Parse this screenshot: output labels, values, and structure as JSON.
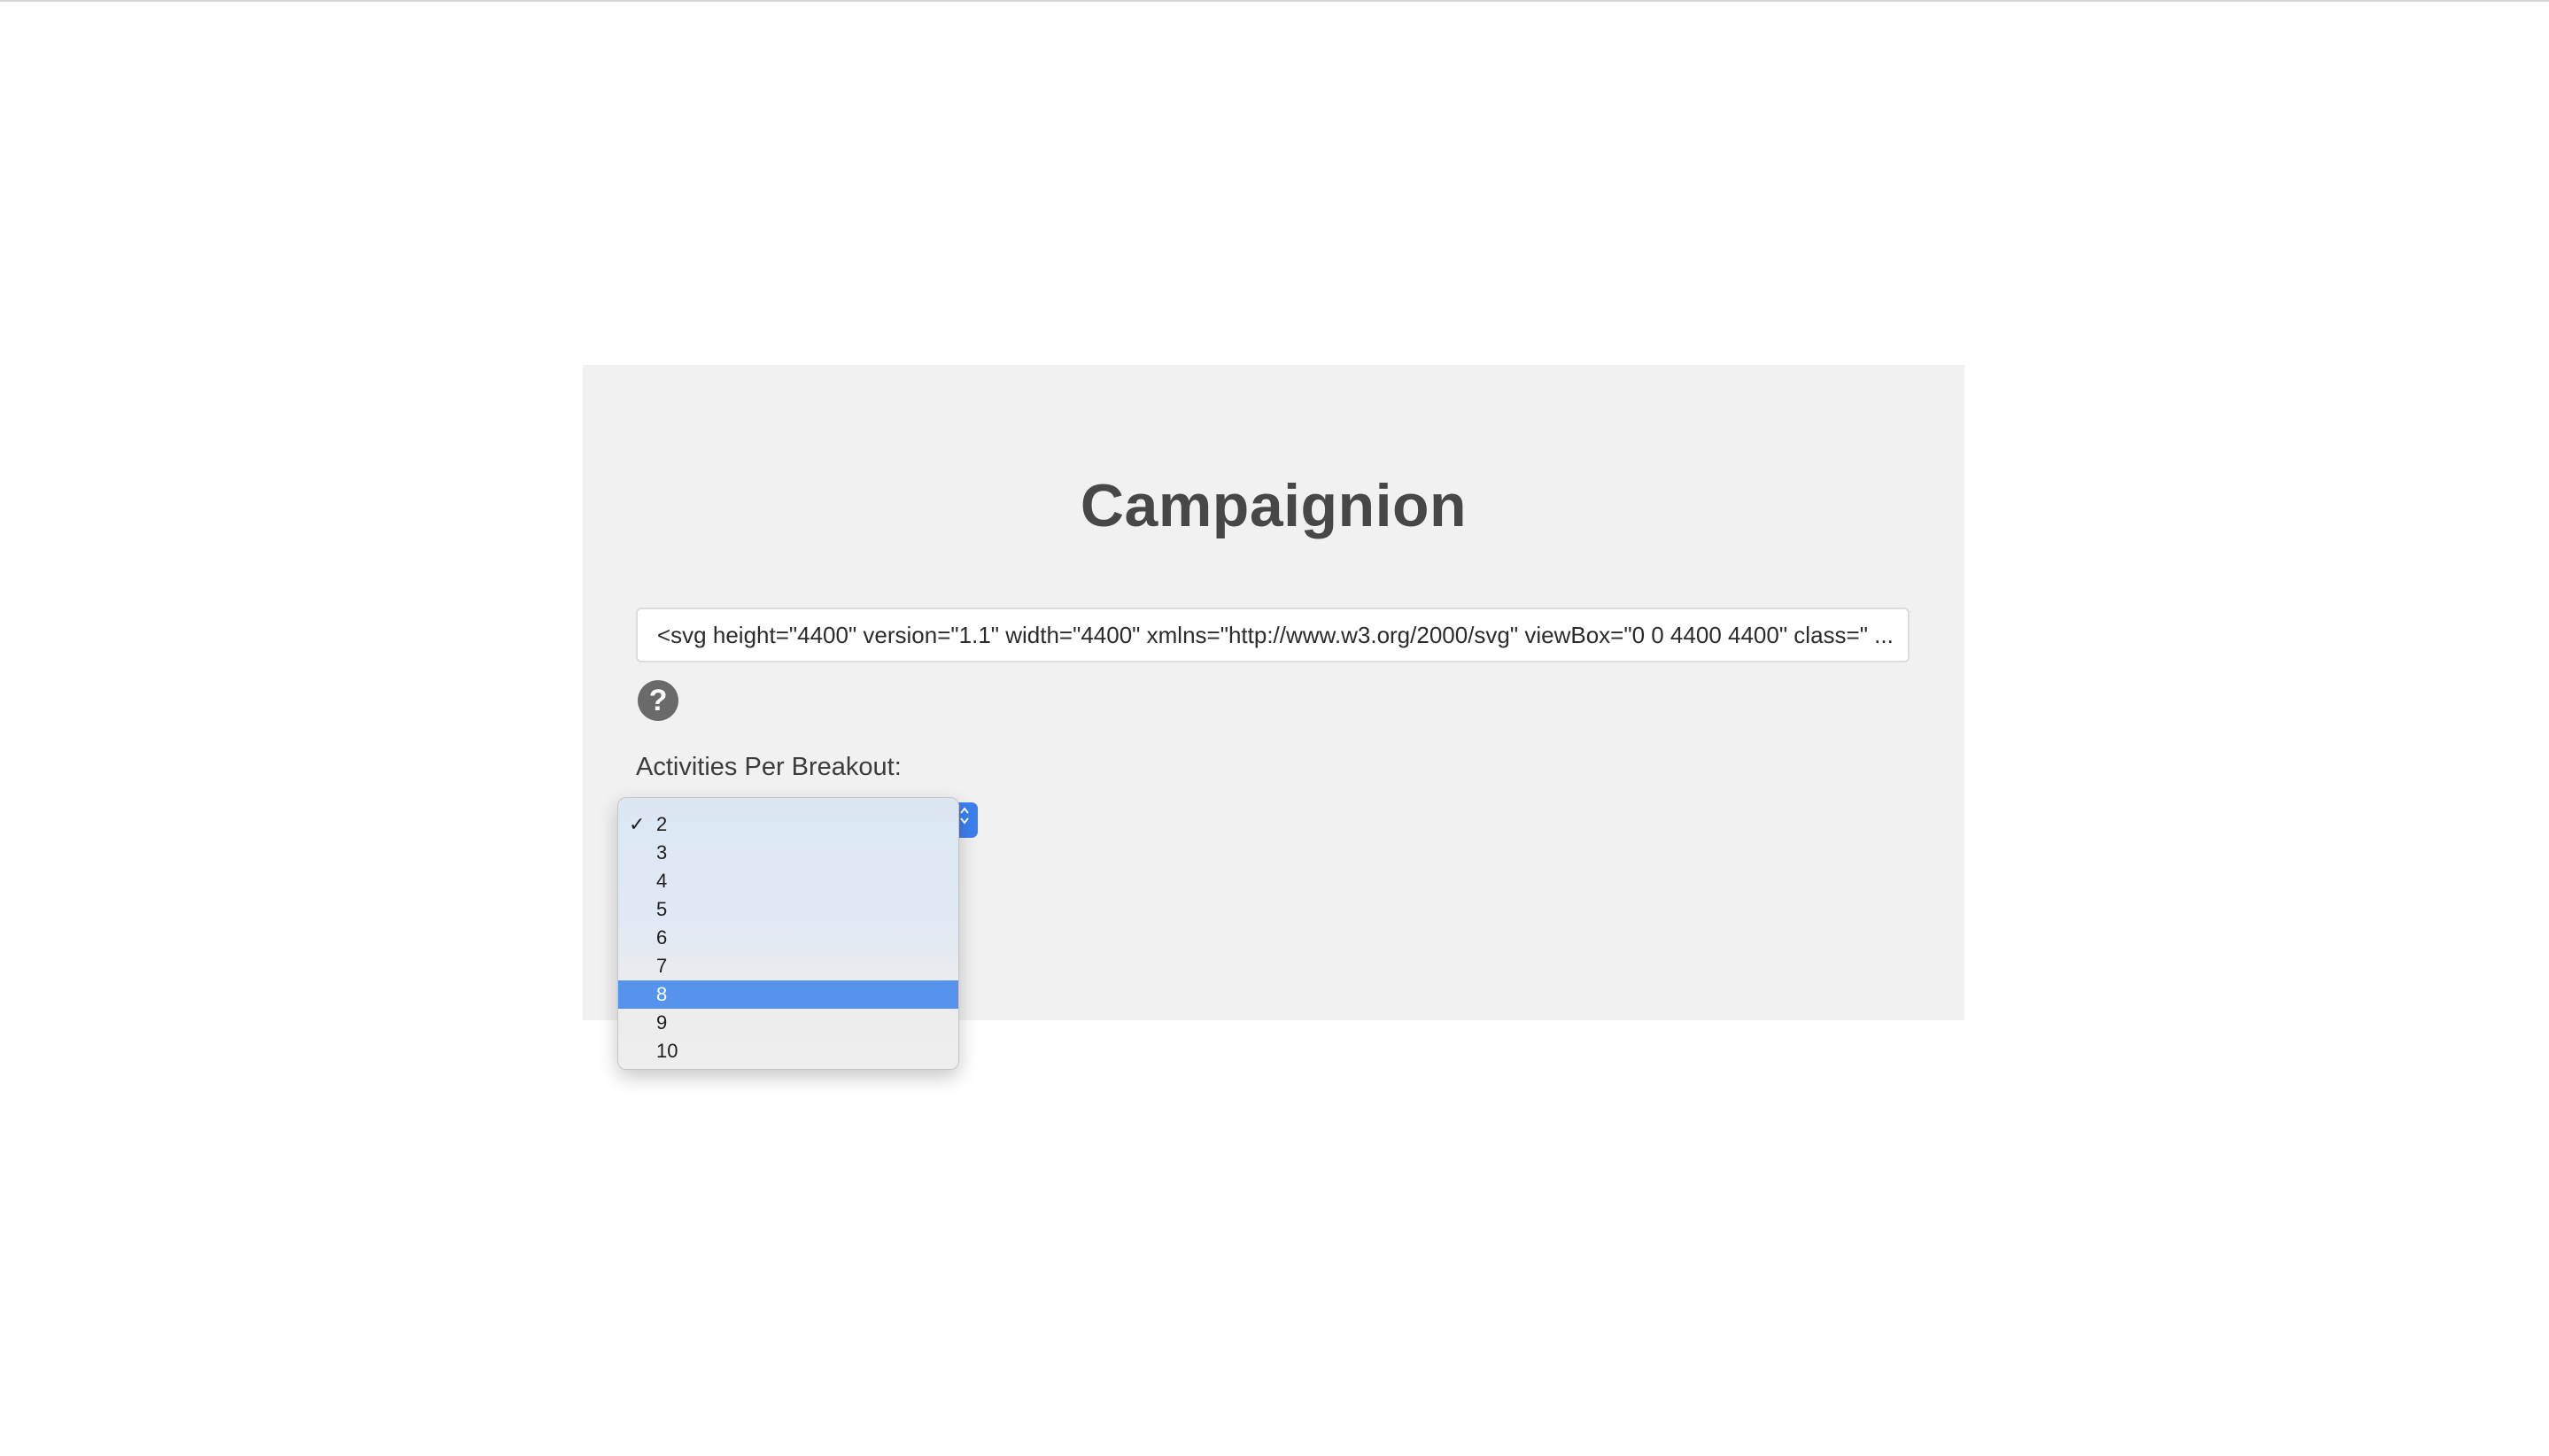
{
  "page": {
    "title": "Campaignion"
  },
  "svg_field": {
    "value": "<svg height=\"4400\" version=\"1.1\" width=\"4400\" xmlns=\"http://www.w3.org/2000/svg\" viewBox=\"0 0 4400 4400\" class=\" ..."
  },
  "help": {
    "icon": "question-circle-icon",
    "glyph": "?"
  },
  "activities": {
    "label": "Activities Per Breakout:",
    "selected": "2",
    "highlighted": "8",
    "check_glyph": "✓",
    "stepper_glyph": "⌃⌄",
    "options": [
      "2",
      "3",
      "4",
      "5",
      "6",
      "7",
      "8",
      "9",
      "10"
    ]
  },
  "colors": {
    "panel_bg": "#f1f1f1",
    "title": "#474747",
    "highlight": "#5593ec",
    "select_accent": "#3b7ff0"
  }
}
